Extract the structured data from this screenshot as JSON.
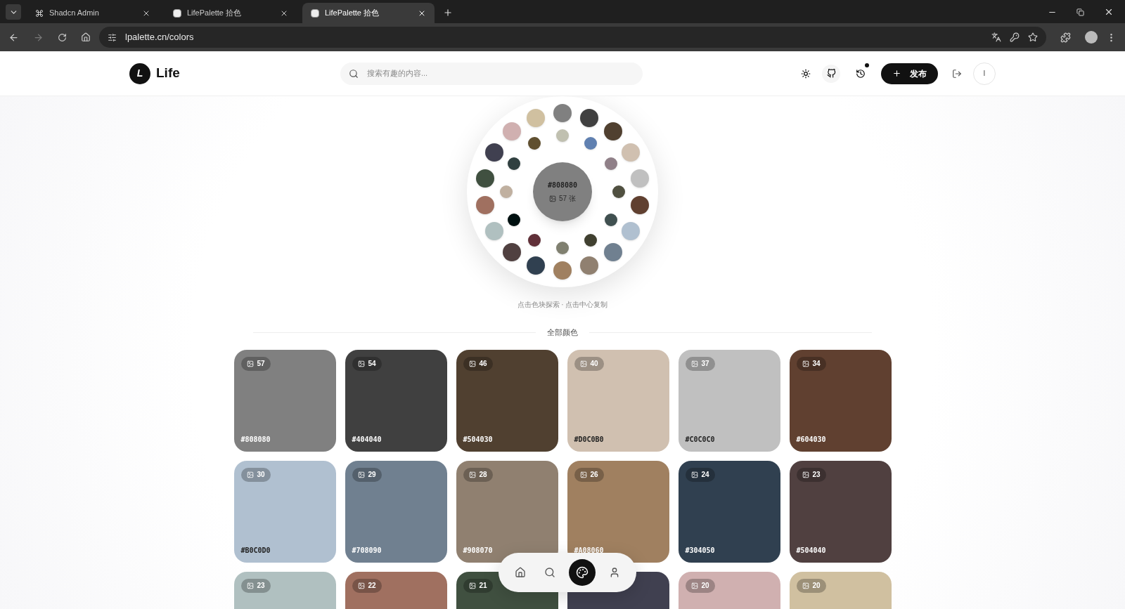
{
  "browser": {
    "tabs": [
      {
        "title": "Shadcn Admin",
        "kind": "command",
        "selected": false
      },
      {
        "title": "LifePalette 拾色",
        "kind": "page",
        "selected": false
      },
      {
        "title": "LifePalette 拾色",
        "kind": "page",
        "selected": true
      }
    ],
    "url": "lpalette.cn/colors"
  },
  "header": {
    "logo_letter": "L",
    "brand": "Life",
    "search": {
      "placeholder": "搜索有趣的内容..."
    },
    "history_badge": true,
    "publish_button": "发布",
    "avatar_letter": "I"
  },
  "wheel": {
    "center": {
      "hex": "#808080",
      "count": "57 张",
      "color": "#808080"
    },
    "outer": [
      {
        "color": "#808080"
      },
      {
        "color": "#404040"
      },
      {
        "color": "#504030"
      },
      {
        "color": "#d0c0b0"
      },
      {
        "color": "#c0c0c0"
      },
      {
        "color": "#604030"
      },
      {
        "color": "#b0c0d0"
      },
      {
        "color": "#708090"
      },
      {
        "color": "#908070"
      },
      {
        "color": "#a08060"
      },
      {
        "color": "#304050"
      },
      {
        "color": "#504040"
      },
      {
        "color": "#b0c0c0"
      },
      {
        "color": "#a07060"
      },
      {
        "color": "#405040"
      },
      {
        "color": "#404050"
      },
      {
        "color": "#d0b0b0"
      },
      {
        "color": "#d0c0a0"
      }
    ],
    "inner": [
      {
        "color": "#c0c0b0"
      },
      {
        "color": "#6080b0"
      },
      {
        "color": "#908088"
      },
      {
        "color": "#505040"
      },
      {
        "color": "#405050"
      },
      {
        "color": "#404030"
      },
      {
        "color": "#808070"
      },
      {
        "color": "#603038"
      },
      {
        "color": "#001010"
      },
      {
        "color": "#c0b0a0"
      },
      {
        "color": "#304040"
      },
      {
        "color": "#605030"
      }
    ],
    "hint": "点击色块探索 · 点击中心复制"
  },
  "section_title": "全部颜色",
  "cards": [
    {
      "color": "#808080",
      "count": "57",
      "hex": "#808080"
    },
    {
      "color": "#404040",
      "count": "54",
      "hex": "#404040"
    },
    {
      "color": "#504030",
      "count": "46",
      "hex": "#504030"
    },
    {
      "color": "#d0c0b0",
      "count": "40",
      "hex": "#D0C0B0"
    },
    {
      "color": "#c0c0c0",
      "count": "37",
      "hex": "#C0C0C0"
    },
    {
      "color": "#604030",
      "count": "34",
      "hex": "#604030"
    },
    {
      "color": "#b0c0d0",
      "count": "30",
      "hex": "#B0C0D0"
    },
    {
      "color": "#708090",
      "count": "29",
      "hex": "#708090"
    },
    {
      "color": "#908070",
      "count": "28",
      "hex": "#908070"
    },
    {
      "color": "#a08060",
      "count": "26",
      "hex": "#A08060"
    },
    {
      "color": "#304050",
      "count": "24",
      "hex": "#304050"
    },
    {
      "color": "#504040",
      "count": "23",
      "hex": "#504040"
    },
    {
      "color": "#b0c0c0",
      "count": "23"
    },
    {
      "color": "#a07060",
      "count": "22"
    },
    {
      "color": "#405040",
      "count": "21"
    },
    {
      "color": "#404050"
    },
    {
      "color": "#d0b0b0",
      "count": "20"
    },
    {
      "color": "#d0c0a0",
      "count": "20"
    }
  ],
  "bottom_nav": [
    {
      "kind": "home",
      "selected": false
    },
    {
      "kind": "search",
      "selected": false
    },
    {
      "kind": "palette",
      "selected": true
    },
    {
      "kind": "user",
      "selected": false
    }
  ]
}
